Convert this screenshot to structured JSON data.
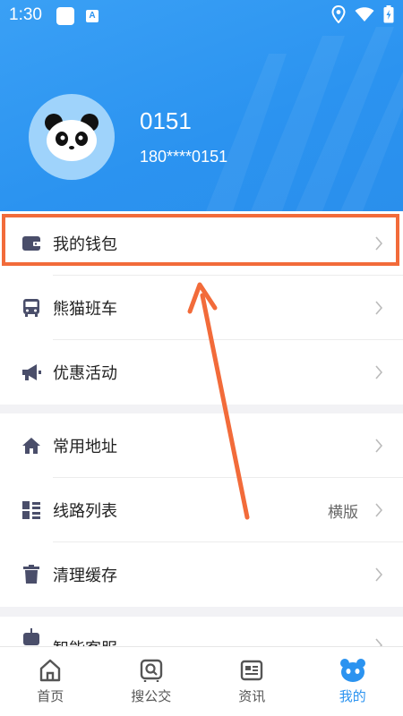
{
  "status": {
    "time": "1:30",
    "notif_letter": "A"
  },
  "profile": {
    "name": "0151",
    "phone": "180****0151"
  },
  "menu": {
    "group1": [
      {
        "label": "我的钱包",
        "icon": "wallet-icon"
      },
      {
        "label": "熊猫班车",
        "icon": "bus-icon"
      },
      {
        "label": "优惠活动",
        "icon": "megaphone-icon"
      }
    ],
    "group2": [
      {
        "label": "常用地址",
        "icon": "home-icon"
      },
      {
        "label": "线路列表",
        "icon": "list-icon",
        "extra": "横版"
      },
      {
        "label": "清理缓存",
        "icon": "trash-icon"
      }
    ],
    "group3": [
      {
        "label": "智能客服",
        "icon": "robot-icon"
      }
    ]
  },
  "nav": [
    {
      "label": "首页",
      "icon": "home-outline-icon"
    },
    {
      "label": "搜公交",
      "icon": "search-bus-icon"
    },
    {
      "label": "资讯",
      "icon": "news-icon"
    },
    {
      "label": "我的",
      "icon": "panda-icon",
      "active": true
    }
  ],
  "colors": {
    "primary": "#2b93f0",
    "highlight": "#f26b3a",
    "icon": "#4a4e6a"
  }
}
